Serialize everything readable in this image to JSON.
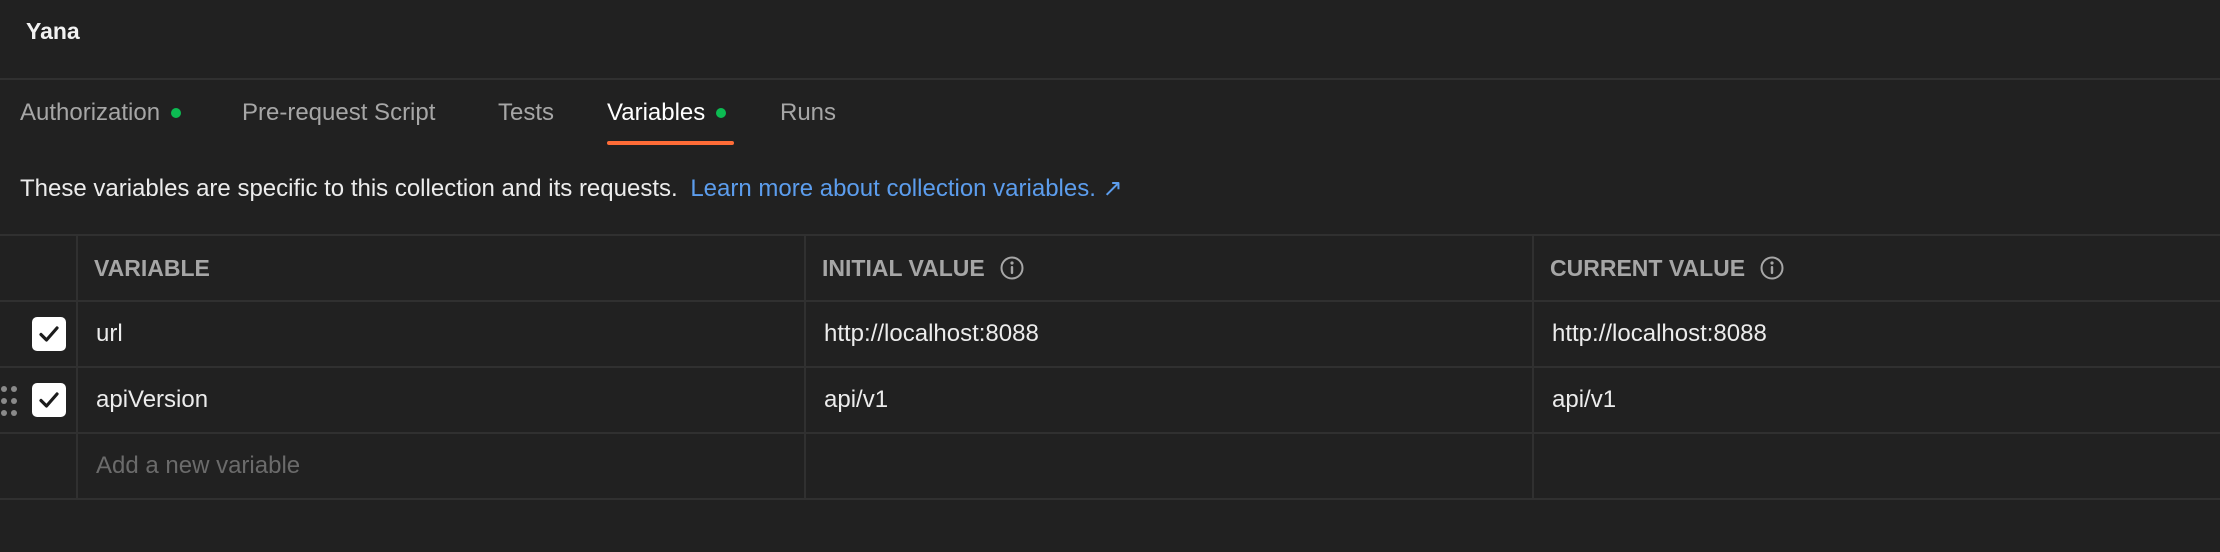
{
  "header": {
    "title": "Yana"
  },
  "tabs": [
    {
      "label": "Authorization",
      "has_dot": true
    },
    {
      "label": "Pre-request Script",
      "has_dot": false
    },
    {
      "label": "Tests",
      "has_dot": false
    },
    {
      "label": "Variables",
      "has_dot": true,
      "active": true
    },
    {
      "label": "Runs",
      "has_dot": false
    }
  ],
  "description": {
    "text": "These variables are specific to this collection and its requests.",
    "link": "Learn more about collection variables. ↗"
  },
  "table": {
    "headers": {
      "variable": "VARIABLE",
      "initial": "INITIAL VALUE",
      "current": "CURRENT VALUE"
    },
    "rows": [
      {
        "enabled": true,
        "variable": "url",
        "initial": "http://localhost:8088",
        "current": "http://localhost:8088"
      },
      {
        "enabled": true,
        "variable": "apiVersion",
        "initial": "api/v1",
        "current": "api/v1"
      }
    ],
    "new_placeholder": "Add a new variable"
  },
  "colors": {
    "background": "#212121",
    "accent": "#ff6c37",
    "status_dot": "#0cbb52",
    "link": "#5c9ded",
    "border": "#303030"
  },
  "icons": [
    "info-icon",
    "checkmark-icon",
    "drag-handle-icon",
    "external-link-icon"
  ]
}
